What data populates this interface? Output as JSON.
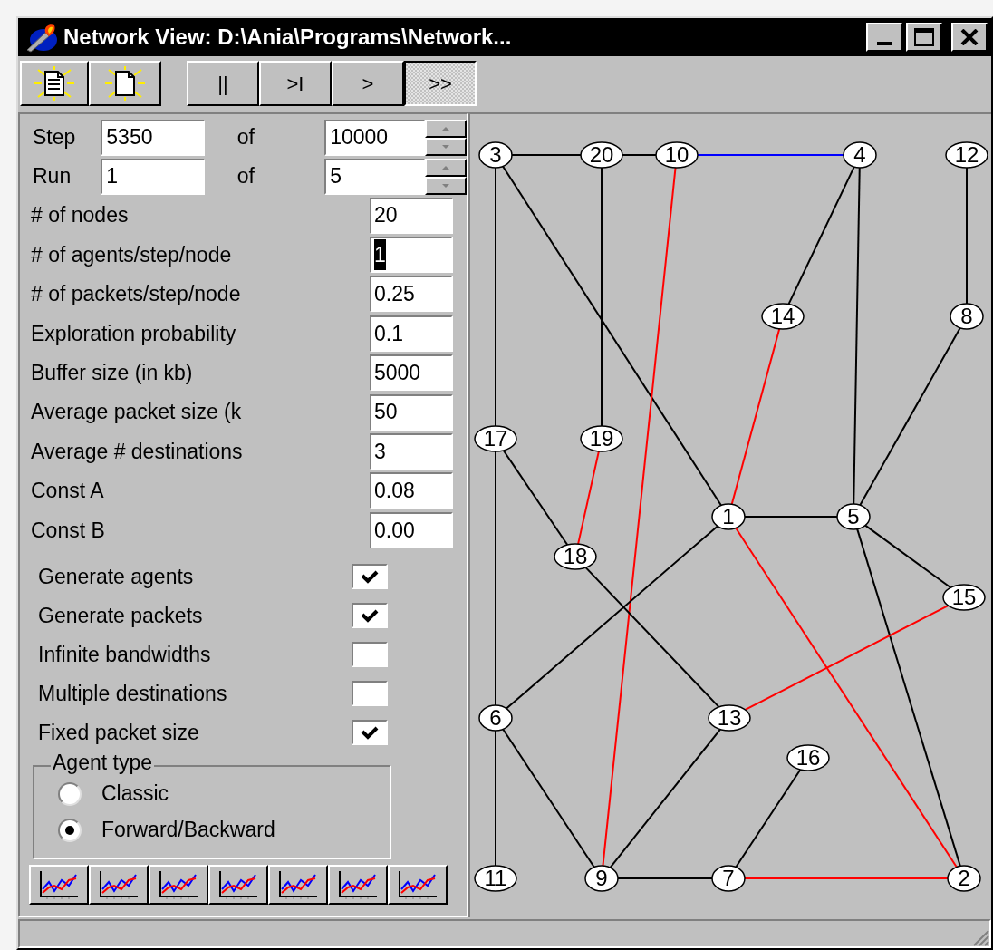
{
  "window": {
    "title": "Network View: D:\\Ania\\Programs\\Network..."
  },
  "toolbar": {
    "playback": [
      {
        "label": "||",
        "selected": false
      },
      {
        "label": ">I",
        "selected": false
      },
      {
        "label": ">",
        "selected": false
      },
      {
        "label": ">>",
        "selected": true
      }
    ]
  },
  "step": {
    "label": "Step",
    "value": "5350",
    "of": "of",
    "total": "10000"
  },
  "run": {
    "label": "Run",
    "value": "1",
    "of": "of",
    "total": "5"
  },
  "parameters": [
    {
      "label": "# of nodes",
      "value": "20",
      "highlighted": false
    },
    {
      "label": "# of agents/step/node",
      "value": "1",
      "highlighted": true
    },
    {
      "label": "# of packets/step/node",
      "value": "0.25",
      "highlighted": false
    },
    {
      "label": "Exploration probability",
      "value": "0.1",
      "highlighted": false
    },
    {
      "label": "Buffer size (in kb)",
      "value": "5000",
      "highlighted": false
    },
    {
      "label": "Average packet size (k",
      "value": "50",
      "highlighted": false
    },
    {
      "label": "Average # destinations",
      "value": "3",
      "highlighted": false
    },
    {
      "label": "Const A",
      "value": "0.08",
      "highlighted": false
    },
    {
      "label": "Const B",
      "value": "0.00",
      "highlighted": false
    }
  ],
  "options": [
    {
      "label": "Generate agents",
      "checked": true
    },
    {
      "label": "Generate packets",
      "checked": true
    },
    {
      "label": "Infinite bandwidths",
      "checked": false
    },
    {
      "label": "Multiple destinations",
      "checked": false
    },
    {
      "label": "Fixed packet size",
      "checked": true
    }
  ],
  "agent_type": {
    "title": "Agent type",
    "options": [
      {
        "label": "Classic",
        "selected": false
      },
      {
        "label": "Forward/Backward",
        "selected": true
      }
    ]
  },
  "graph": {
    "nodes": [
      {
        "label": "3"
      },
      {
        "label": "20"
      },
      {
        "label": "10"
      },
      {
        "label": "4"
      },
      {
        "label": "12"
      },
      {
        "label": "14"
      },
      {
        "label": "8"
      },
      {
        "label": "17"
      },
      {
        "label": "19"
      },
      {
        "label": "1"
      },
      {
        "label": "5"
      },
      {
        "label": "18"
      },
      {
        "label": "15"
      },
      {
        "label": "6"
      },
      {
        "label": "13"
      },
      {
        "label": "16"
      },
      {
        "label": "11"
      },
      {
        "label": "9"
      },
      {
        "label": "7"
      },
      {
        "label": "2"
      }
    ],
    "edges": [
      {
        "color": "#000000"
      },
      {
        "color": "#000000"
      },
      {
        "color": "#0000ff"
      },
      {
        "color": "#000000"
      },
      {
        "color": "#000000"
      },
      {
        "color": "#000000"
      },
      {
        "color": "#ff0000"
      },
      {
        "color": "#000000"
      },
      {
        "color": "#000000"
      },
      {
        "color": "#000000"
      },
      {
        "color": "#ff0000"
      },
      {
        "color": "#000000"
      },
      {
        "color": "#000000"
      },
      {
        "color": "#000000"
      },
      {
        "color": "#000000"
      },
      {
        "color": "#000000"
      },
      {
        "color": "#ff0000"
      },
      {
        "color": "#000000"
      },
      {
        "color": "#000000"
      },
      {
        "color": "#ff0000"
      },
      {
        "color": "#000000"
      },
      {
        "color": "#000000"
      },
      {
        "color": "#ff0000"
      },
      {
        "color": "#000000"
      },
      {
        "color": "#000000"
      },
      {
        "color": "#000000"
      },
      {
        "color": "#000000"
      },
      {
        "color": "#ff0000"
      }
    ]
  }
}
